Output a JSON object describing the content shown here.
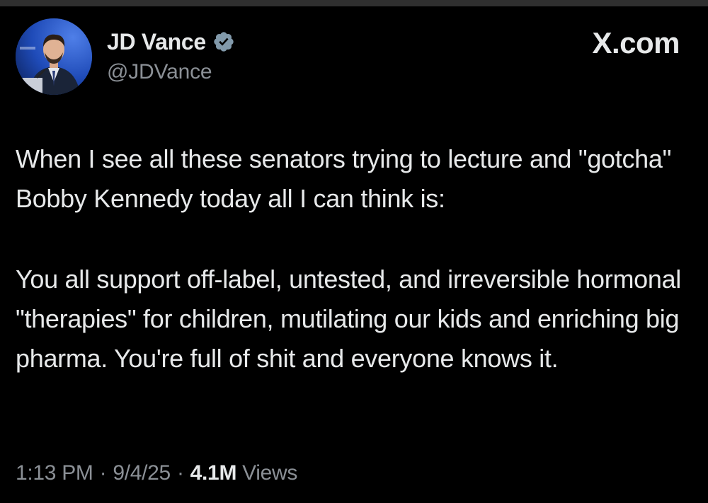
{
  "tweet": {
    "author": {
      "display_name": "JD Vance",
      "handle": "@JDVance",
      "verified_badge_icon": "verified-checkmark-icon"
    },
    "site_label": "X.com",
    "text_paragraphs": [
      "When I see all these senators trying to lecture and \"gotcha\" Bobby Kennedy today all I can think is:",
      "You all support off-label, untested, and irreversible hormonal \"therapies\" for children, mutilating our kids and enriching big pharma. You're full of shit and everyone knows it."
    ],
    "time": "1:13 PM",
    "date": "9/4/25",
    "separator": "·",
    "views_count": "4.1M",
    "views_label": "Views"
  },
  "colors": {
    "background": "#000000",
    "primary_text": "#e7e9ea",
    "secondary_text": "#8b9096",
    "verified_badge": "#829aab"
  }
}
